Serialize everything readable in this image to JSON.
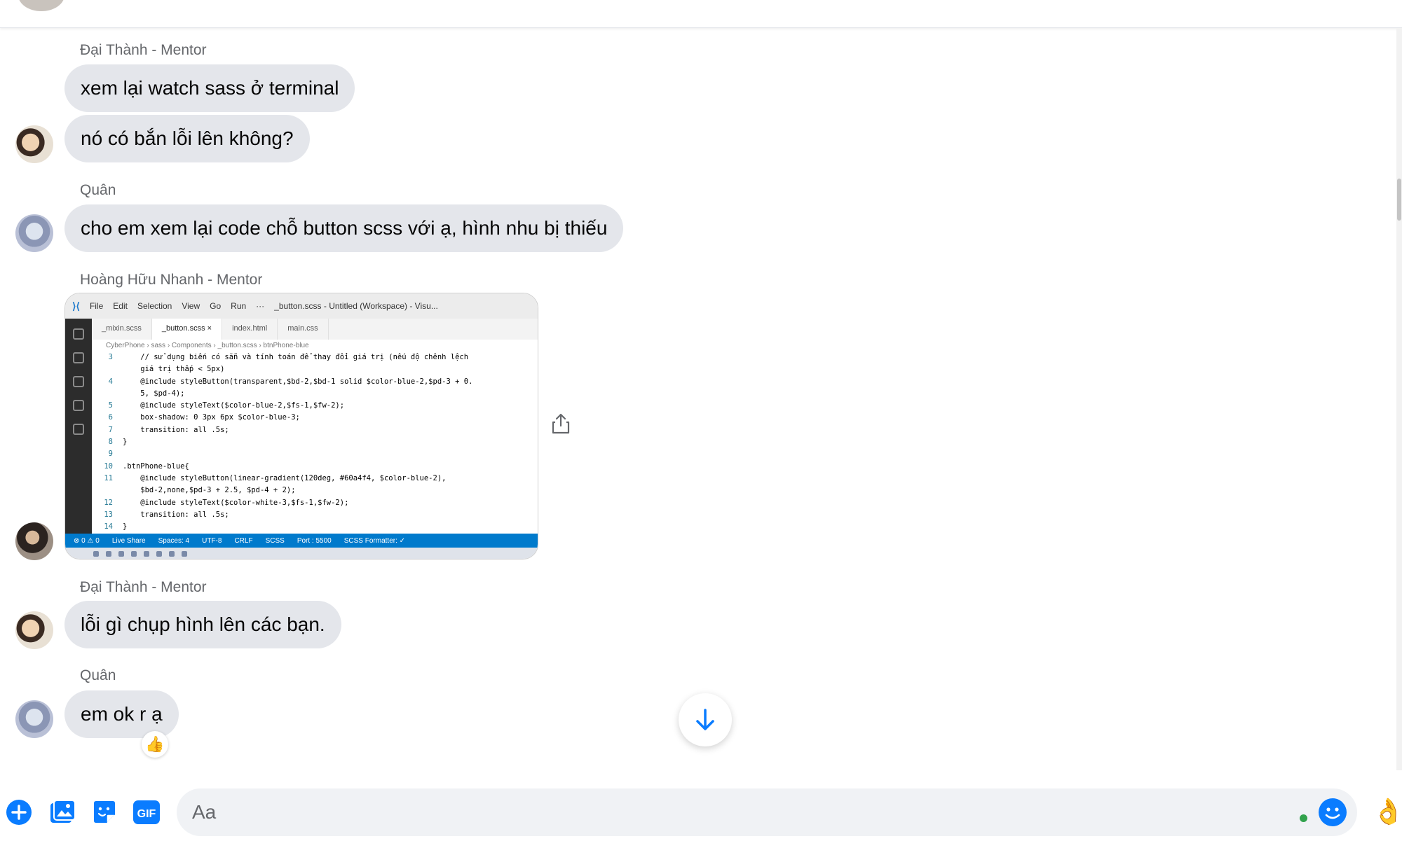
{
  "conversation": {
    "messages": [
      {
        "sender": "Đại Thành - Mentor",
        "text": "xem lại watch sass ở terminal"
      },
      {
        "text": "nó có bắn lỗi lên không?"
      },
      {
        "sender": "Quân",
        "text": "cho em xem lại code chỗ button scss với ạ, hình nhu bị thiếu"
      },
      {
        "sender": "Hoàng Hữu Nhanh - Mentor"
      },
      {
        "sender": "Đại Thành - Mentor",
        "text": "lỗi gì chụp hình lên các bạn."
      },
      {
        "sender": "Quân",
        "text": "em ok r ạ",
        "reaction": "👍"
      }
    ]
  },
  "screenshot": {
    "menu": [
      "File",
      "Edit",
      "Selection",
      "View",
      "Go",
      "Run",
      "···"
    ],
    "window_title": "_button.scss - Untitled (Workspace) - Visu...",
    "tabs": [
      "_mixin.scss",
      "_button.scss ×",
      "index.html",
      "main.css"
    ],
    "breadcrumb": "CyberPhone › sass › Components › _button.scss › btnPhone-blue",
    "code": [
      {
        "ln": "3",
        "text": "    // sử dụng biến có sẵn và tính toán để thay đổi giá trị (nếu độ chênh lệch"
      },
      {
        "ln": "",
        "text": "    giá trị thấp < 5px)"
      },
      {
        "ln": "4",
        "text": "    @include styleButton(transparent,$bd-2,$bd-1 solid $color-blue-2,$pd-3 + 0."
      },
      {
        "ln": "",
        "text": "    5, $pd-4);"
      },
      {
        "ln": "5",
        "text": "    @include styleText($color-blue-2,$fs-1,$fw-2);"
      },
      {
        "ln": "6",
        "text": "    box-shadow: 0 3px 6px $color-blue-3;"
      },
      {
        "ln": "7",
        "text": "    transition: all .5s;"
      },
      {
        "ln": "8",
        "text": "}"
      },
      {
        "ln": "9",
        "text": ""
      },
      {
        "ln": "10",
        "text": ".btnPhone-blue{"
      },
      {
        "ln": "11",
        "text": "    @include styleButton(linear-gradient(120deg, #60a4f4, $color-blue-2),"
      },
      {
        "ln": "",
        "text": "    $bd-2,none,$pd-3 + 2.5, $pd-4 + 2);"
      },
      {
        "ln": "12",
        "text": "    @include styleText($color-white-3,$fs-1,$fw-2);"
      },
      {
        "ln": "13",
        "text": "    transition: all .5s;"
      },
      {
        "ln": "14",
        "text": "}"
      }
    ],
    "status": [
      "⊗ 0 ⚠ 0",
      "Live Share",
      "Spaces: 4",
      "UTF-8",
      "CRLF",
      "SCSS",
      "Port : 5500",
      "SCSS Formatter: ✓"
    ]
  },
  "composer": {
    "placeholder": "Aa",
    "icons": [
      "plus-icon",
      "image-icon",
      "sticker-icon",
      "gif-icon",
      "emoji-icon",
      "hand-icon"
    ],
    "gif_label": "GIF"
  },
  "colors": {
    "accent": "#0a7cff",
    "bubble": "#e4e6eb",
    "sender_text": "#65676b"
  }
}
